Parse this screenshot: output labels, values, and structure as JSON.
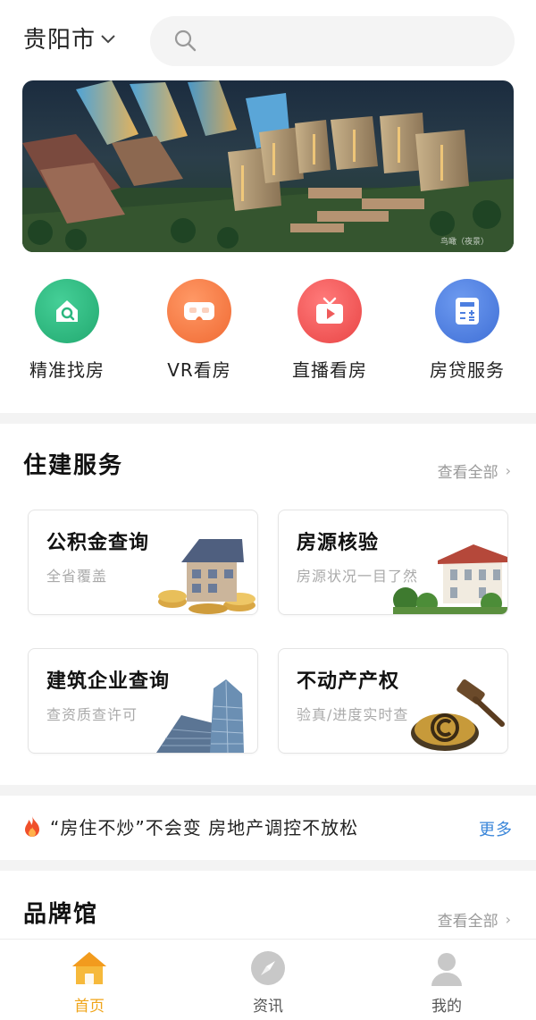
{
  "header": {
    "city": "贵阳市",
    "search_placeholder": ""
  },
  "banner": {
    "caption": "鸟瞰（夜景）"
  },
  "quick_nav": [
    {
      "label": "精准找房",
      "icon": "house-search-icon",
      "color": "#2bb77f"
    },
    {
      "label": "VR看房",
      "icon": "vr-headset-icon",
      "color": "#f47a45"
    },
    {
      "label": "直播看房",
      "icon": "tv-live-icon",
      "color": "#ef5b5b"
    },
    {
      "label": "房贷服务",
      "icon": "calculator-icon",
      "color": "#4d7fe0"
    }
  ],
  "housing_services": {
    "title": "住建服务",
    "more": "查看全部",
    "cards": [
      {
        "title": "公积金查询",
        "subtitle": "全省覆盖"
      },
      {
        "title": "房源核验",
        "subtitle": "房源状况一目了然"
      },
      {
        "title": "建筑企业查询",
        "subtitle": "查资质查许可"
      },
      {
        "title": "不动产产权",
        "subtitle": "验真/进度实时查"
      }
    ]
  },
  "news": {
    "headline": "“房住不炒”不会变 房地产调控不放松",
    "more": "更多"
  },
  "brand": {
    "title": "品牌馆",
    "more": "查看全部"
  },
  "tabbar": [
    {
      "label": "首页",
      "icon": "home-icon",
      "active": true
    },
    {
      "label": "资讯",
      "icon": "compass-icon",
      "active": false
    },
    {
      "label": "我的",
      "icon": "user-icon",
      "active": false
    }
  ],
  "colors": {
    "accent": "#f0a51a",
    "link": "#3a86d9"
  }
}
